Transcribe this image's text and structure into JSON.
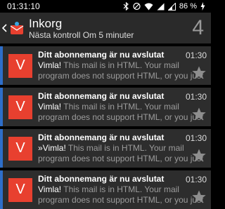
{
  "status": {
    "time": "01:31:10",
    "battery": "86 %"
  },
  "header": {
    "title": "Inkorg",
    "subtitle": "Nästa kontroll Om 5 minuter",
    "unread": "4"
  },
  "messages": [
    {
      "avatar": "V",
      "subject": "Ditt abonnemang är nu avslutat",
      "time": "01:30",
      "sender": "Vimla!",
      "preview_line1": " This mail is in HTML. Your mail",
      "preview_line2": "program does not support HTML, or you just"
    },
    {
      "avatar": "V",
      "subject": "Ditt abonnemang är nu avslutat",
      "time": "01:30",
      "sender": "Vimla!",
      "preview_line1": " This mail is in HTML. Your mail",
      "preview_line2": "program does not support HTML, or you just"
    },
    {
      "avatar": "V",
      "subject": "Ditt abonnemang är nu avslutat",
      "time": "01:30",
      "sender": "»Vimla!",
      "preview_line1": " This mail is in HTML. Your mail",
      "preview_line2": "program does not support HTML, or you just"
    },
    {
      "avatar": "V",
      "subject": "Ditt abonnemang är nu avslutat",
      "time": "01:30",
      "sender": "Vimla!",
      "preview_line1": " This mail is in HTML. Your mail",
      "preview_line2": "program does not support HTML, or you just"
    }
  ],
  "colors": {
    "accent": "#2e6ec9",
    "avatar": "#e8402f"
  }
}
